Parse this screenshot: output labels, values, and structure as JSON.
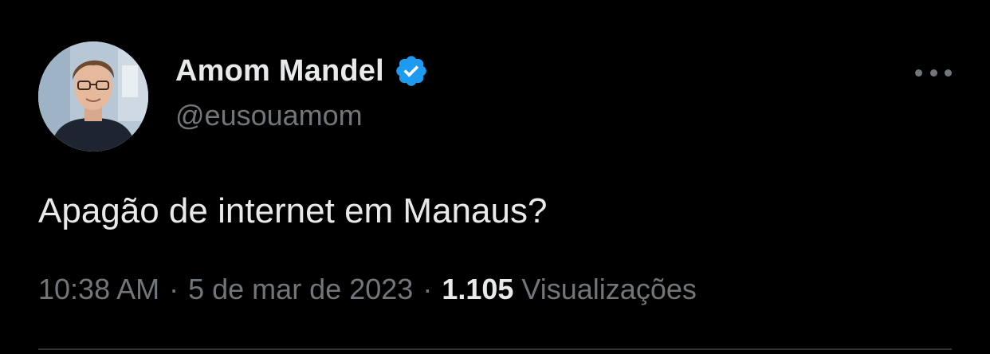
{
  "author": {
    "display_name": "Amom Mandel",
    "handle": "@eusouamom",
    "verified": true,
    "verified_badge_color": "#1d9bf0",
    "avatar_icon": "user-avatar-photo"
  },
  "tweet": {
    "text": "Apagão de internet em Manaus?",
    "time": "10:38 AM",
    "date": "5 de mar de 2023",
    "separator": "·",
    "views_count": "1.105",
    "views_label": "Visualizações"
  },
  "menu": {
    "icon": "more-options-icon"
  },
  "colors": {
    "background": "#000000",
    "primary_text": "#e7e9ea",
    "secondary_text": "#71767b",
    "divider": "#2f3336"
  }
}
